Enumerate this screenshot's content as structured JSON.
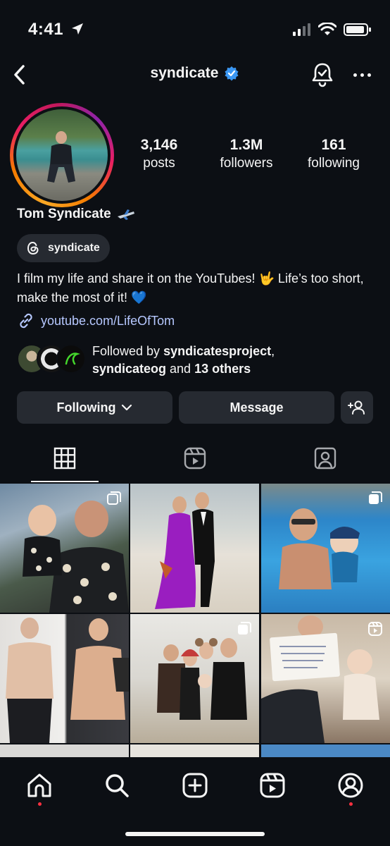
{
  "status": {
    "time": "4:41"
  },
  "header": {
    "username": "syndicate"
  },
  "profile": {
    "stats": [
      {
        "value": "3,146",
        "label": "posts"
      },
      {
        "value": "1.3M",
        "label": "followers"
      },
      {
        "value": "161",
        "label": "following"
      }
    ],
    "display_name": "Tom Syndicate",
    "threads_handle": "syndicate",
    "bio": "I film my life and share it on the YouTubes! 🤟 Life’s too short, make the most of it! 💙",
    "link": "youtube.com/LifeOfTom",
    "followed_by": {
      "prefix": "Followed by ",
      "user1": "syndicatesproject",
      "sep": ",",
      "user2": "syndicateog",
      "mid": " and ",
      "others": "13 others"
    }
  },
  "actions": {
    "following": "Following",
    "message": "Message"
  },
  "tabs": [
    "posts-grid",
    "reels",
    "tagged"
  ],
  "nav": [
    "home",
    "search",
    "create",
    "reels",
    "profile"
  ],
  "colors": {
    "background": "#0c0f14",
    "button": "#262a31",
    "verified": "#3b97f3",
    "link": "#b6c8ff",
    "notification_dot": "#ff3040"
  }
}
